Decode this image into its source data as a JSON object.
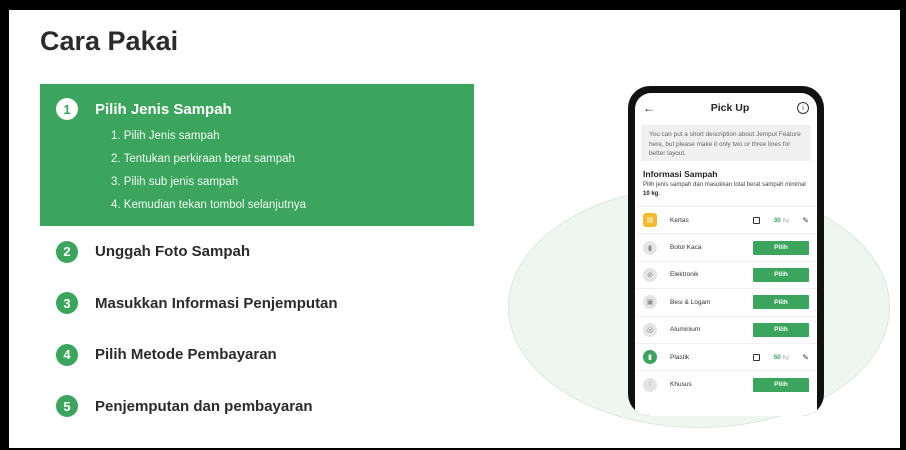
{
  "page": {
    "title": "Cara Pakai"
  },
  "steps": {
    "active": {
      "number": "1",
      "title": "Pilih Jenis Sampah",
      "substeps": [
        "1. Pilih Jenis sampah",
        "2. Tentukan perkiraan berat sampah",
        "3. Pilih sub jenis sampah",
        "4. Kemudian tekan tombol selanjutnya"
      ]
    },
    "others": [
      {
        "number": "2",
        "title": "Unggah Foto Sampah"
      },
      {
        "number": "3",
        "title": "Masukkan Informasi Penjemputan"
      },
      {
        "number": "4",
        "title": "Pilih Metode Pembayaran"
      },
      {
        "number": "5",
        "title": "Penjemputan dan pembayaran"
      }
    ]
  },
  "phone": {
    "appbar": {
      "back": "←",
      "title": "Pick Up",
      "info": "i"
    },
    "description": "You can put a short description about Jemput Feature here, but please make it only two or three lines for better layout.",
    "info_title": "Informasi Sampah",
    "info_desc_prefix": "Pilih jenis sampah dan masukkan total berat sampah minimal ",
    "info_desc_bold": "10 kg",
    "info_desc_suffix": ".",
    "pilih_label": "Pilih",
    "unit": "Kg",
    "items": [
      {
        "name": "Kertas",
        "weight": "30"
      },
      {
        "name": "Botol Kaca"
      },
      {
        "name": "Elektronik"
      },
      {
        "name": "Besi & Logam"
      },
      {
        "name": "Aluminium"
      },
      {
        "name": "Plastik",
        "weight": "50"
      },
      {
        "name": "Khusus"
      }
    ]
  },
  "colors": {
    "accent": "#3ba55d",
    "title": "#2b2b2b",
    "frame": "#000000"
  }
}
